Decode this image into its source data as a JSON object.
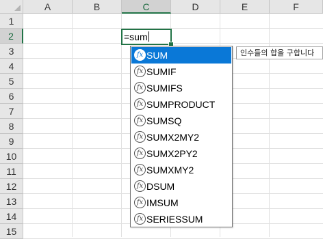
{
  "columns": [
    "A",
    "B",
    "C",
    "D",
    "E",
    "F"
  ],
  "rows": [
    "1",
    "2",
    "3",
    "4",
    "5",
    "6",
    "7",
    "8",
    "9",
    "10",
    "11",
    "12",
    "13",
    "14",
    "15"
  ],
  "active_cell": {
    "column": "C",
    "row": "2",
    "formula_text": "=sum"
  },
  "autocomplete": {
    "items": [
      "SUM",
      "SUMIF",
      "SUMIFS",
      "SUMPRODUCT",
      "SUMSQ",
      "SUMX2MY2",
      "SUMX2PY2",
      "SUMXMY2",
      "DSUM",
      "IMSUM",
      "SERIESSUM"
    ],
    "selected_index": 0,
    "function_icon": "fx-function-icon",
    "tooltip": "인수들의 합을 구합니다"
  },
  "colors": {
    "accent": "#217346",
    "selection": "#0a78d7"
  }
}
